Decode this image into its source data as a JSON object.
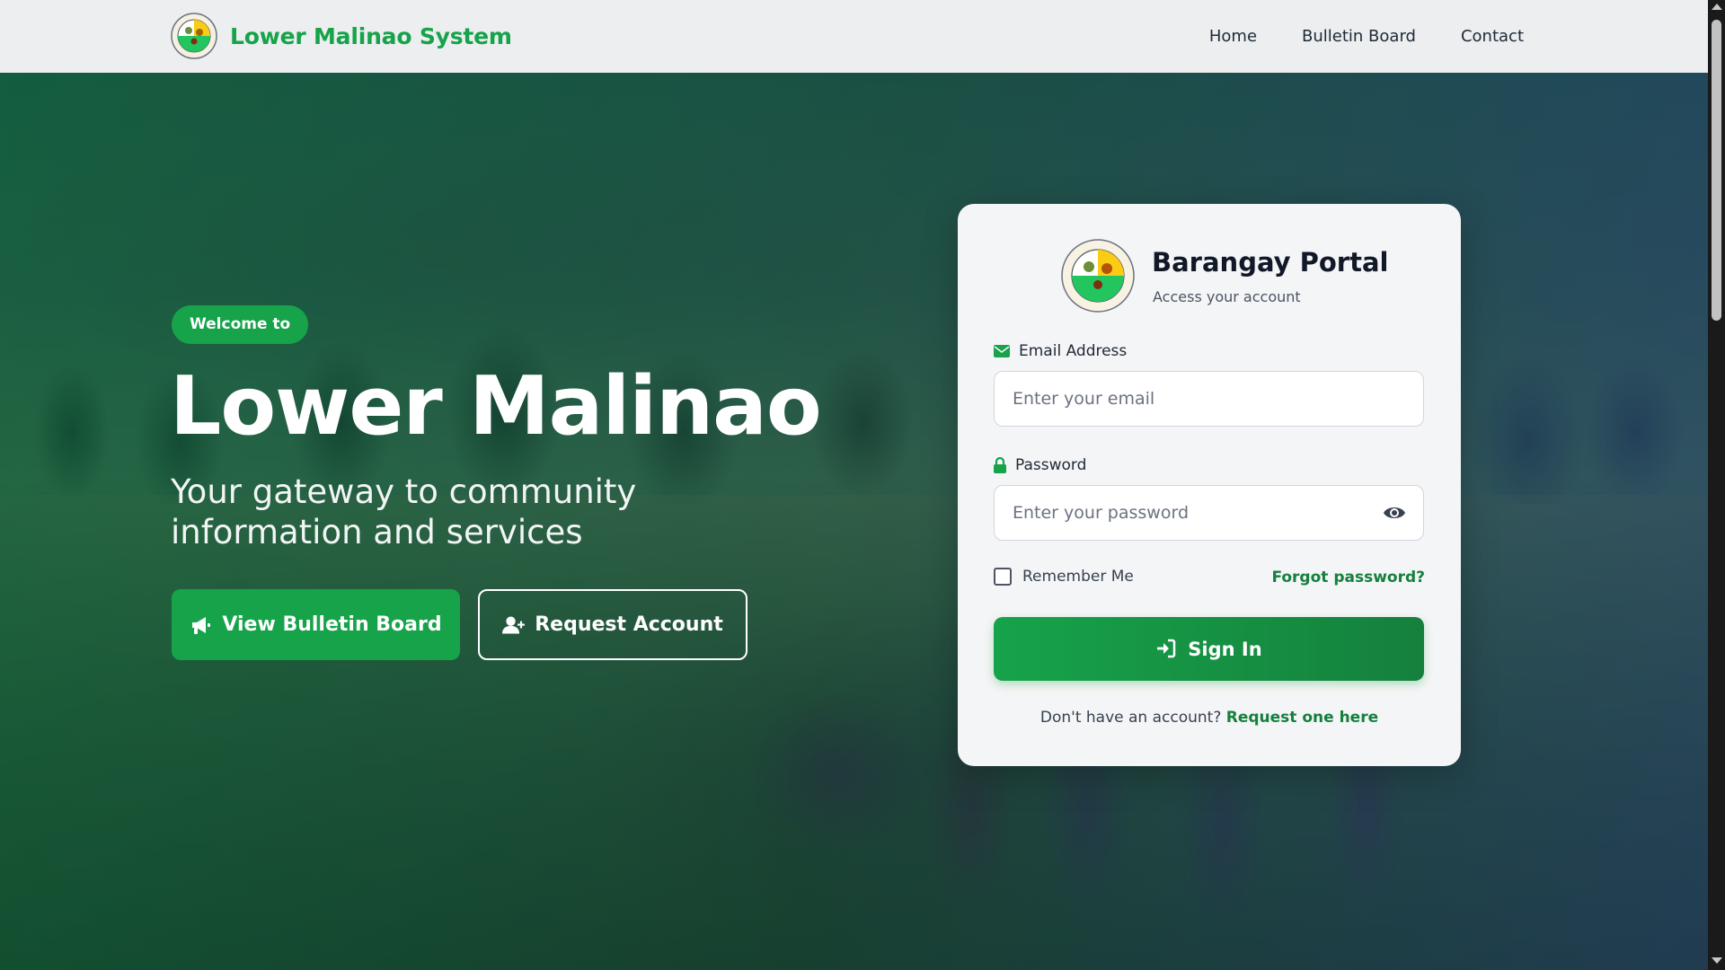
{
  "navbar": {
    "brand_name": "Lower Malinao System",
    "links": [
      "Home",
      "Bulletin Board",
      "Contact"
    ]
  },
  "hero": {
    "badge": "Welcome to",
    "title": "Lower Malinao",
    "subtitle": "Your gateway to community information and services",
    "primary_button": "View Bulletin Board",
    "secondary_button": "Request Account"
  },
  "login": {
    "title": "Barangay Portal",
    "subtitle": "Access your account",
    "email_label": "Email Address",
    "email_placeholder": "Enter your email",
    "password_label": "Password",
    "password_placeholder": "Enter your password",
    "remember_label": "Remember Me",
    "forgot_link": "Forgot password?",
    "signin_button": "Sign In",
    "signup_prompt": "Don't have an account?",
    "signup_link": "Request one here"
  },
  "icons": {
    "brand": "barangay-seal-icon",
    "primary_button": "megaphone-icon",
    "secondary_button": "user-plus-icon",
    "email": "envelope-icon",
    "password": "lock-icon",
    "password_toggle": "eye-icon",
    "signin": "sign-in-icon"
  },
  "colors": {
    "accent": "#16a34a",
    "accent_dark": "#15803d",
    "navbar_bg": "#eceef0",
    "card_bg": "#f4f5f6"
  }
}
